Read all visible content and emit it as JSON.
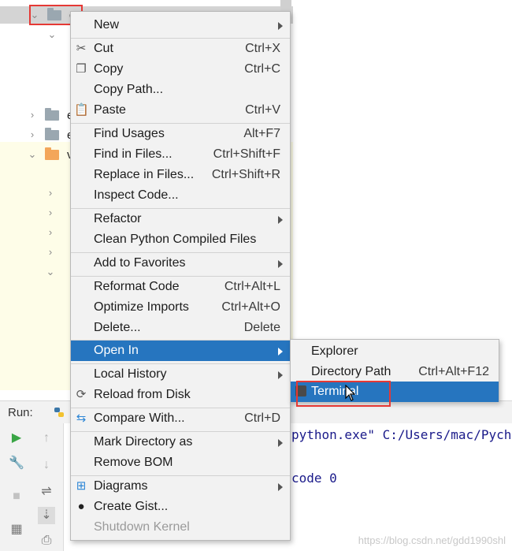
{
  "tree": {
    "selected_label": "c",
    "rows": [
      {
        "label": "e"
      },
      {
        "label": "e"
      },
      {
        "label": "v"
      }
    ]
  },
  "run_panel": {
    "label": "Run:",
    "console_lines": [
      "python.exe\" C:/Users/mac/Pych",
      "code 0"
    ]
  },
  "context_menu": {
    "items": [
      {
        "label": "New",
        "shortcut": "",
        "submenu": true
      },
      {
        "label": "Cut",
        "shortcut": "Ctrl+X",
        "icon": "scissors-icon"
      },
      {
        "label": "Copy",
        "shortcut": "Ctrl+C",
        "icon": "copy-icon"
      },
      {
        "label": "Copy Path...",
        "shortcut": ""
      },
      {
        "label": "Paste",
        "shortcut": "Ctrl+V",
        "icon": "clipboard-icon"
      },
      {
        "label": "Find Usages",
        "shortcut": "Alt+F7"
      },
      {
        "label": "Find in Files...",
        "shortcut": "Ctrl+Shift+F"
      },
      {
        "label": "Replace in Files...",
        "shortcut": "Ctrl+Shift+R"
      },
      {
        "label": "Inspect Code...",
        "shortcut": ""
      },
      {
        "label": "Refactor",
        "shortcut": "",
        "submenu": true
      },
      {
        "label": "Clean Python Compiled Files",
        "shortcut": ""
      },
      {
        "label": "Add to Favorites",
        "shortcut": "",
        "submenu": true
      },
      {
        "label": "Reformat Code",
        "shortcut": "Ctrl+Alt+L"
      },
      {
        "label": "Optimize Imports",
        "shortcut": "Ctrl+Alt+O"
      },
      {
        "label": "Delete...",
        "shortcut": "Delete"
      },
      {
        "label": "Open In",
        "shortcut": "",
        "submenu": true,
        "active": true
      },
      {
        "label": "Local History",
        "shortcut": "",
        "submenu": true
      },
      {
        "label": "Reload from Disk",
        "shortcut": "",
        "icon": "reload-icon"
      },
      {
        "label": "Compare With...",
        "shortcut": "Ctrl+D",
        "icon": "compare-icon"
      },
      {
        "label": "Mark Directory as",
        "shortcut": "",
        "submenu": true
      },
      {
        "label": "Remove BOM",
        "shortcut": ""
      },
      {
        "label": "Diagrams",
        "shortcut": "",
        "submenu": true,
        "icon": "diagram-icon"
      },
      {
        "label": "Create Gist...",
        "shortcut": "",
        "icon": "github-icon"
      },
      {
        "label": "Shutdown Kernel",
        "shortcut": "",
        "disabled": true
      }
    ]
  },
  "submenu": {
    "items": [
      {
        "label": "Explorer",
        "shortcut": ""
      },
      {
        "label": "Directory Path",
        "shortcut": "Ctrl+Alt+F12"
      },
      {
        "label": "Terminal",
        "shortcut": "",
        "hover": true
      }
    ]
  },
  "watermark": "https://blog.csdn.net/gdd1990shl",
  "colors": {
    "accent": "#2675bf",
    "highlight_box": "#e53935",
    "menu_bg": "#f2f2f2"
  }
}
